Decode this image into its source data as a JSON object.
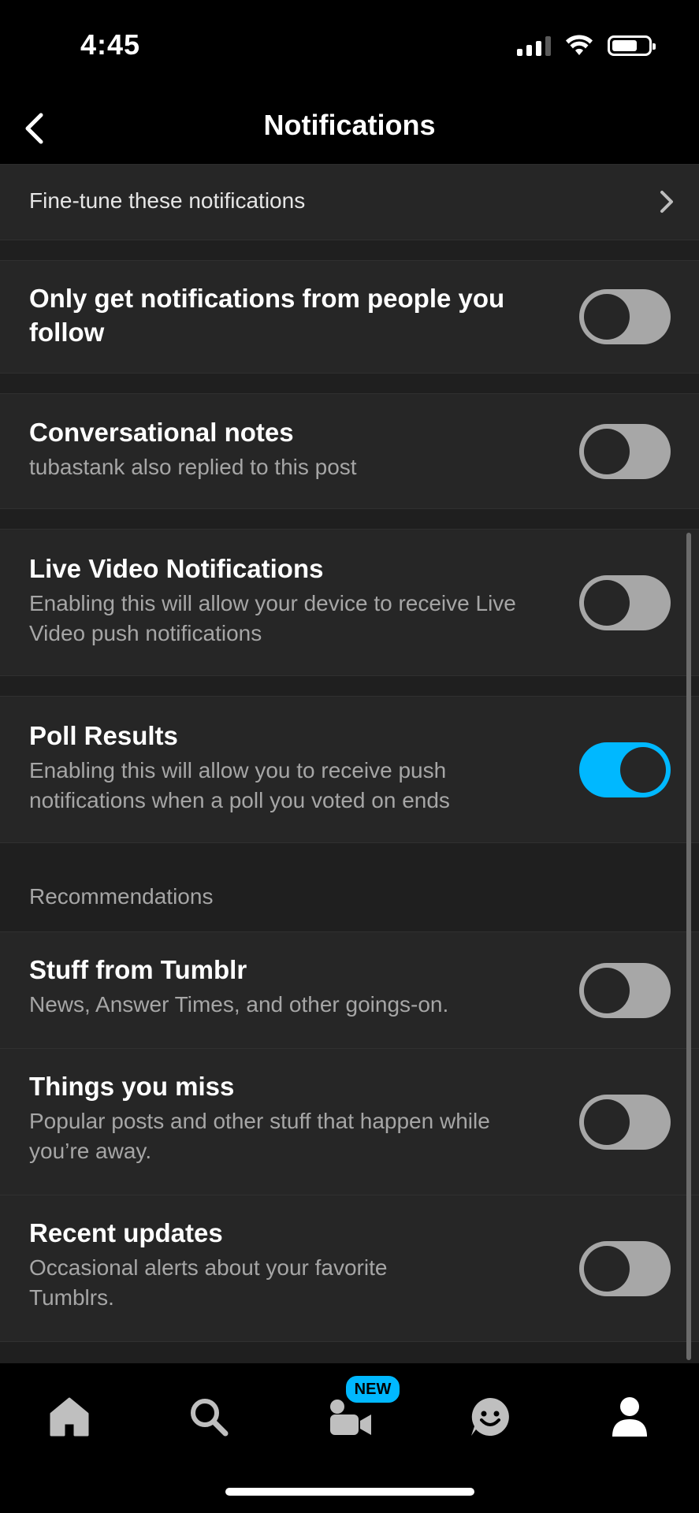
{
  "status_bar": {
    "time": "4:45"
  },
  "nav": {
    "title": "Notifications"
  },
  "fine_tune": {
    "label": "Fine-tune these notifications"
  },
  "settings": [
    {
      "title": "Only get notifications from people you follow",
      "subtitle": "",
      "enabled": false
    },
    {
      "title": "Conversational notes",
      "subtitle": "tubastank also replied to this post",
      "enabled": false
    },
    {
      "title": "Live Video Notifications",
      "subtitle": "Enabling this will allow your device to receive Live Video push notifications",
      "enabled": false
    },
    {
      "title": "Poll Results",
      "subtitle": "Enabling this will allow you to receive push notifications when a poll you voted on ends",
      "enabled": true
    }
  ],
  "recommendations": {
    "header": "Recommendations",
    "items": [
      {
        "title": "Stuff from Tumblr",
        "subtitle": "News, Answer Times, and other goings-on.",
        "enabled": false
      },
      {
        "title": "Things you miss",
        "subtitle": "Popular posts and other stuff that happen while you’re away.",
        "enabled": false
      },
      {
        "title": "Recent updates",
        "subtitle": "Occasional alerts about your favorite Tumblrs.",
        "enabled": false
      }
    ]
  },
  "tabbar": {
    "tabs": [
      "home-icon",
      "search-icon",
      "live-video-icon",
      "activity-icon",
      "account-icon"
    ],
    "new_badge": "NEW"
  },
  "colors": {
    "accent": "#00b8ff",
    "background": "#1f1f1f",
    "row": "#262626"
  }
}
